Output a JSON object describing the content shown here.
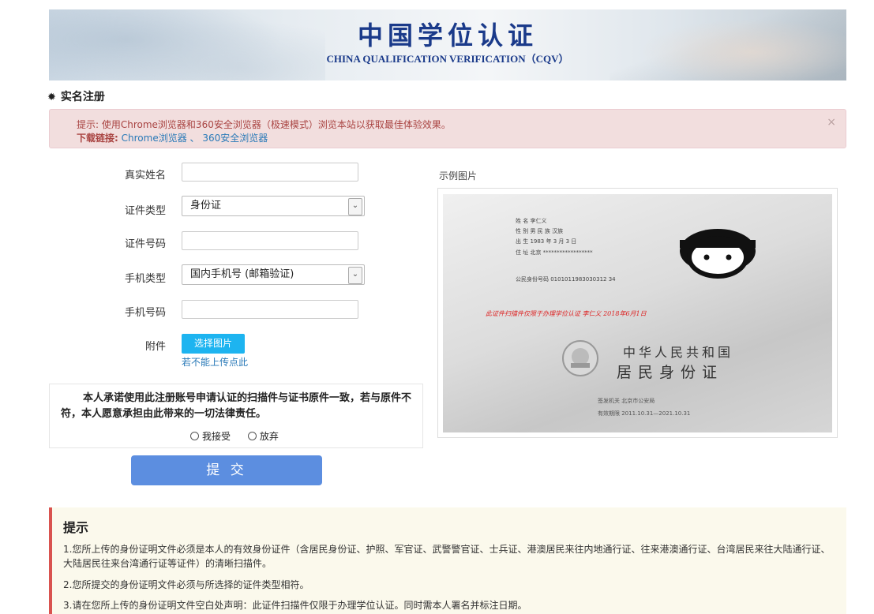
{
  "banner": {
    "title_cn": "中国学位认证",
    "title_en": "CHINA QUALIFICATION VERIFICATION（CQV）"
  },
  "section_title": "实名注册",
  "alert": {
    "tip_prefix": "提示:",
    "tip_text": " 使用Chrome浏览器和360安全浏览器（极速模式）浏览本站以获取最佳体验效果。",
    "download_prefix": "下载链接:",
    "chrome_link": "Chrome浏览器",
    "separator": "、",
    "browser360_link": "360安全浏览器",
    "close": "×"
  },
  "form": {
    "real_name_label": "真实姓名",
    "real_name_value": "",
    "id_type_label": "证件类型",
    "id_type_value": "身份证",
    "id_number_label": "证件号码",
    "id_number_value": "",
    "phone_type_label": "手机类型",
    "phone_type_value": "国内手机号 (邮箱验证)",
    "phone_number_label": "手机号码",
    "phone_number_value": "",
    "attachment_label": "附件",
    "choose_image_button": "选择图片",
    "cannot_upload_link": "若不能上传点此"
  },
  "promise": {
    "text": "本人承诺使用此注册账号申请认证的扫描件与证书原件一致，若与原件不符，本人愿意承担由此带来的一切法律责任。",
    "accept_label": "我接受",
    "decline_label": "放弃"
  },
  "submit_label": "提 交",
  "sample": {
    "label": "示例图片",
    "name_line": "姓 名    李仁义",
    "sex_line": "性 别    男       民 族   汉族",
    "birth_line": "出 生    1983 年  3 月  3 日",
    "address_line": "住 址  北京 ******************",
    "id_line": "公民身份号码  0101011983030312 34",
    "handwriting": "此证件扫描件仅限于办理学位认证  李仁义  2018年6月1日",
    "country": "中华人民共和国",
    "card_title": "居民身份证",
    "authority_line": "签发机关    北京市公安局",
    "validity_line": "有效期限    2011.10.31—2021.10.31"
  },
  "tips": {
    "heading": "提示",
    "items": [
      "1.您所上传的身份证明文件必须是本人的有效身份证件（含居民身份证、护照、军官证、武警警官证、士兵证、港澳居民来往内地通行证、往来港澳通行证、台湾居民来往大陆通行证、大陆居民往来台湾通行证等证件）的清晰扫描件。",
      "2.您所提交的身份证明文件必须与所选择的证件类型相符。",
      "3.请在您所上传的身份证明文件空白处声明：此证件扫描件仅限于办理学位认证。同时需本人署名并标注日期。"
    ]
  },
  "colors": {
    "accent": "#5c8ee0",
    "upload": "#1db4f0",
    "alert_bg": "#f2dede",
    "alert_text": "#a94442",
    "tip_border": "#d9534f",
    "banner_text": "#1a3a8a"
  }
}
